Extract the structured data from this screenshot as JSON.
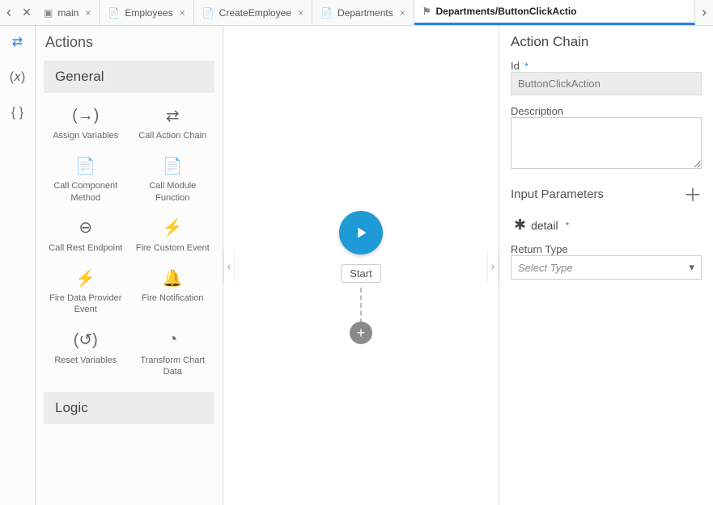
{
  "tabs": [
    {
      "icon": "▣",
      "label": "main",
      "close": "×",
      "active": false
    },
    {
      "icon": "📄",
      "label": "Employees",
      "close": "×",
      "active": false
    },
    {
      "icon": "📄",
      "label": "CreateEmployee",
      "close": "×",
      "active": false
    },
    {
      "icon": "📄",
      "label": "Departments",
      "close": "×",
      "active": false
    },
    {
      "icon": "⚑",
      "label": "Departments/ButtonClickActio",
      "close": "",
      "active": true
    }
  ],
  "nav": {
    "back": "‹",
    "forward_small": "×",
    "overflow": "›"
  },
  "toolstrip": {
    "chain": "⇄",
    "var": "(𝑥)",
    "code": "{ }"
  },
  "actionsPanel": {
    "title": "Actions",
    "groups": {
      "general": {
        "header": "General",
        "items": [
          {
            "icon": "(→)",
            "label": "Assign Variables"
          },
          {
            "icon": "⇄",
            "label": "Call Action Chain"
          },
          {
            "icon": "📄",
            "label": "Call Component Method"
          },
          {
            "icon": "📄",
            "label": "Call Module Function"
          },
          {
            "icon": "⊖",
            "label": "Call Rest Endpoint"
          },
          {
            "icon": "⚡",
            "label": "Fire Custom Event"
          },
          {
            "icon": "⚡",
            "label": "Fire Data Provider Event"
          },
          {
            "icon": "🔔",
            "label": "Fire Notification"
          },
          {
            "icon": "(↺)",
            "label": "Reset Variables"
          },
          {
            "icon": "◔",
            "label": "Transform Chart Data"
          }
        ]
      },
      "logic": {
        "header": "Logic"
      }
    }
  },
  "canvas": {
    "collapse_left": "‹",
    "collapse_right": "›",
    "start_label": "Start",
    "add": "+"
  },
  "props": {
    "title": "Action Chain",
    "id_label": "Id",
    "id_value": "ButtonClickAction",
    "desc_label": "Description",
    "desc_value": "",
    "params_label": "Input Parameters",
    "param0": "detail",
    "return_label": "Return Type",
    "return_placeholder": "Select Type",
    "required_mark": "*",
    "add_plus": "＋"
  }
}
